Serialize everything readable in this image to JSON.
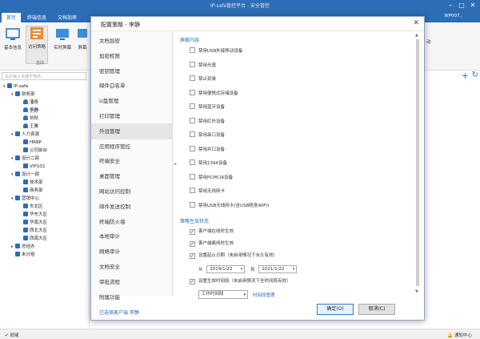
{
  "app": {
    "title": "IP-safe管控平台 - 安全管控",
    "window_controls": [
      "–",
      "□",
      "✕"
    ],
    "menu": [
      "首页",
      "终端信息",
      "文档加密",
      "",
      "",
      "",
      "",
      "",
      ""
    ],
    "user": "WP007..",
    "accent": "#2d6db5"
  },
  "ribbon": {
    "buttons": [
      {
        "label": "基本信息",
        "icon": "info-icon"
      },
      {
        "label": "访问策略",
        "icon": "policy-icon"
      },
      {
        "label": "实时屏幕",
        "icon": "screen-icon"
      },
      {
        "label": "屏幕",
        "icon": "screen-record-icon"
      }
    ],
    "group_label": "基础",
    "right_label": "动"
  },
  "tree": {
    "search_placeholder": "在此输入关键字筛选...",
    "items": [
      {
        "text": "IP-safe",
        "type": "org",
        "level": 0,
        "toggle": "▾"
      },
      {
        "text": "财务部",
        "type": "org",
        "level": 1,
        "toggle": "▾"
      },
      {
        "text": "潘奇",
        "type": "user",
        "level": 2,
        "toggle": ""
      },
      {
        "text": "李静",
        "type": "user",
        "level": 2,
        "toggle": "",
        "selected": true
      },
      {
        "text": "刘秋",
        "type": "user",
        "level": 2,
        "toggle": ""
      },
      {
        "text": "王雅",
        "type": "user",
        "level": 2,
        "toggle": ""
      },
      {
        "text": "人力资源",
        "type": "org",
        "level": 1,
        "toggle": "▾"
      },
      {
        "text": "HRBP",
        "type": "org",
        "level": 2,
        "toggle": ""
      },
      {
        "text": "公司前台",
        "type": "org",
        "level": 2,
        "toggle": ""
      },
      {
        "text": "设计二部",
        "type": "org",
        "level": 1,
        "toggle": "▾"
      },
      {
        "text": "VIP102",
        "type": "pc",
        "level": 2,
        "toggle": ""
      },
      {
        "text": "设计一部",
        "type": "org",
        "level": 1,
        "toggle": "▾"
      },
      {
        "text": "技术部",
        "type": "org",
        "level": 2,
        "toggle": ""
      },
      {
        "text": "商务部",
        "type": "org",
        "level": 2,
        "toggle": ""
      },
      {
        "text": "营销中心",
        "type": "org",
        "level": 1,
        "toggle": "▾"
      },
      {
        "text": "东北区",
        "type": "org",
        "level": 2,
        "toggle": ""
      },
      {
        "text": "华东大区",
        "type": "org",
        "level": 2,
        "toggle": ""
      },
      {
        "text": "华南大区",
        "type": "org",
        "level": 2,
        "toggle": ""
      },
      {
        "text": "西北大区",
        "type": "org",
        "level": 2,
        "toggle": ""
      },
      {
        "text": "西南大区",
        "type": "org",
        "level": 2,
        "toggle": ""
      },
      {
        "text": "总经办",
        "type": "org",
        "level": 1,
        "toggle": "▸"
      },
      {
        "text": "未分组",
        "type": "org",
        "level": 1,
        "toggle": ""
      }
    ]
  },
  "dialog": {
    "title": "配置策略 - 李静",
    "close": "✕",
    "nav": [
      "文档加密",
      "加密权限",
      "密钥管理",
      "邮件白名单",
      "U盘管理",
      "打印管理",
      "外设管理",
      "应用程序管控",
      "终端安全",
      "桌面管理",
      "网站访问控制",
      "邮件发送控制",
      "终端防火墙",
      "本地审计",
      "网络审计",
      "文档安全",
      "审批流程",
      "附属功能"
    ],
    "nav_selected": 6,
    "footer_selected": "已选择客户端 李静",
    "section1": "屏蔽内容",
    "devices": [
      {
        "label": "禁用USB外接移动设备",
        "checked": false
      },
      {
        "label": "禁用光驱",
        "checked": false
      },
      {
        "label": "禁止刻录",
        "checked": false
      },
      {
        "label": "禁用便携式存储设备",
        "checked": false
      },
      {
        "label": "禁用蓝牙设备",
        "checked": false
      },
      {
        "label": "禁用红外设备",
        "checked": false
      },
      {
        "label": "禁用串口设备",
        "checked": false
      },
      {
        "label": "禁用并口设备",
        "checked": false
      },
      {
        "label": "禁用1394设备",
        "checked": false
      },
      {
        "label": "禁用PCMCIA设备",
        "checked": false
      },
      {
        "label": "禁用无线网卡",
        "checked": false
      },
      {
        "label": "禁用USB无线网卡(含USB随身WIFI)",
        "checked": false
      }
    ],
    "section2": "策略生效状态",
    "status": [
      {
        "label": "客户端在线时生效",
        "checked": true
      },
      {
        "label": "客户端离线时生效",
        "checked": true
      },
      {
        "label": "设置起止日期（未启用情况下永久有效）",
        "checked": true
      }
    ],
    "date_from_label": "从",
    "date_from": "2019/1/22",
    "date_to_label": "到",
    "date_to": "2021/1/22",
    "time_check": {
      "label": "设置生效时间段（未启用情况下全时间段有效）",
      "checked": true
    },
    "time_select": "工作时间段",
    "time_link": "时间段管理",
    "ok": "确定(O)",
    "cancel": "取消(C)"
  },
  "status": {
    "ready": "就绪",
    "notice": "通知中心"
  }
}
